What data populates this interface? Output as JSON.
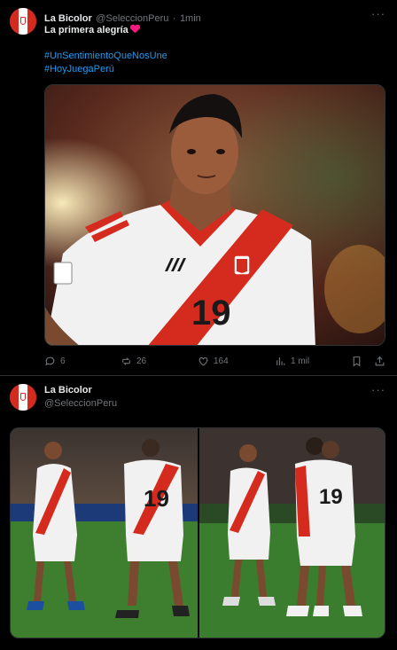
{
  "tweet1": {
    "author_name": "La Bicolor",
    "handle": "@SeleccionPeru",
    "separator": "·",
    "time": "1min",
    "text": "La primera alegría",
    "hashtags": [
      "#UnSentimientoQueNosUne",
      "#HoyJuegaPerú"
    ],
    "actions": {
      "replies": "6",
      "reposts": "26",
      "likes": "164",
      "views": "1 mil"
    },
    "photo": {
      "jersey_number": "19"
    }
  },
  "tweet2": {
    "author_name": "La Bicolor",
    "handle": "@SeleccionPeru",
    "photo_left": {
      "jersey_number": "19"
    },
    "photo_right": {
      "jersey_number": "19"
    }
  },
  "more_label": "···",
  "colors": {
    "background": "#000000",
    "text": "#e7e9ea",
    "muted": "#71767b",
    "link": "#1d9bf0",
    "heart": "#f91880",
    "peru_red": "#d52b1e"
  }
}
